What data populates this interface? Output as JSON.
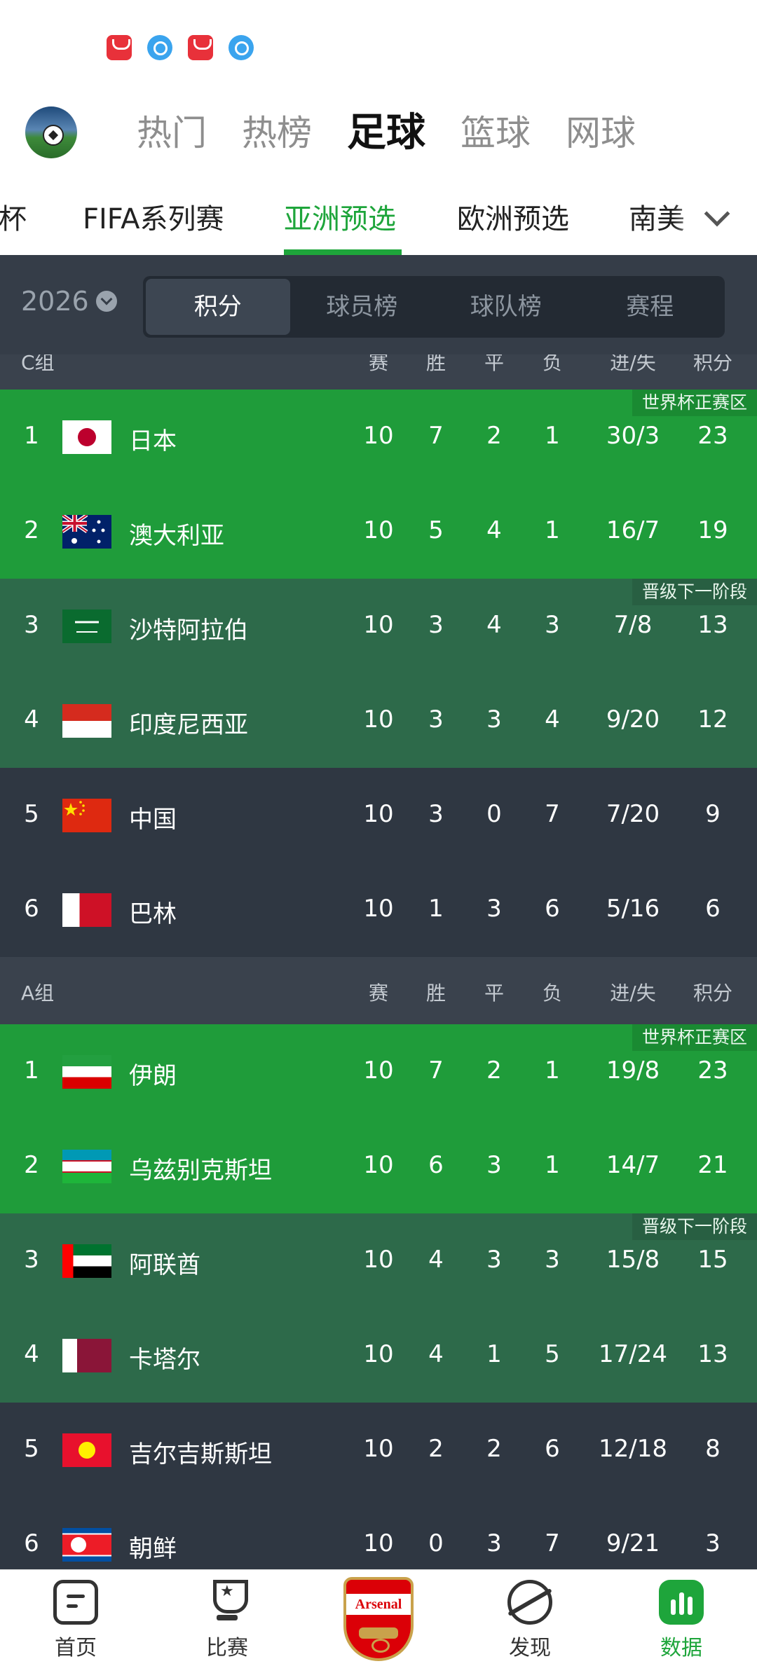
{
  "top_tabs": [
    "热门",
    "热榜",
    "足球",
    "篮球",
    "网球"
  ],
  "sub_tabs": [
    "杯",
    "FIFA系列赛",
    "亚洲预选",
    "欧洲预选",
    "南美"
  ],
  "season": "2026",
  "segments": [
    "积分",
    "球员榜",
    "球队榜",
    "赛程"
  ],
  "headers": [
    "赛",
    "胜",
    "平",
    "负",
    "进/失",
    "积分"
  ],
  "tags": {
    "world_cup": "世界杯正赛区",
    "next": "晋级下一阶段"
  },
  "groups": [
    {
      "name": "C组",
      "rows": [
        {
          "rank": "1",
          "team": "日本",
          "p": "10",
          "w": "7",
          "d": "2",
          "l": "1",
          "gd": "30/3",
          "pts": "23"
        },
        {
          "rank": "2",
          "team": "澳大利亚",
          "p": "10",
          "w": "5",
          "d": "4",
          "l": "1",
          "gd": "16/7",
          "pts": "19"
        },
        {
          "rank": "3",
          "team": "沙特阿拉伯",
          "p": "10",
          "w": "3",
          "d": "4",
          "l": "3",
          "gd": "7/8",
          "pts": "13"
        },
        {
          "rank": "4",
          "team": "印度尼西亚",
          "p": "10",
          "w": "3",
          "d": "3",
          "l": "4",
          "gd": "9/20",
          "pts": "12"
        },
        {
          "rank": "5",
          "team": "中国",
          "p": "10",
          "w": "3",
          "d": "0",
          "l": "7",
          "gd": "7/20",
          "pts": "9"
        },
        {
          "rank": "6",
          "team": "巴林",
          "p": "10",
          "w": "1",
          "d": "3",
          "l": "6",
          "gd": "5/16",
          "pts": "6"
        }
      ]
    },
    {
      "name": "A组",
      "rows": [
        {
          "rank": "1",
          "team": "伊朗",
          "p": "10",
          "w": "7",
          "d": "2",
          "l": "1",
          "gd": "19/8",
          "pts": "23"
        },
        {
          "rank": "2",
          "team": "乌兹别克斯坦",
          "p": "10",
          "w": "6",
          "d": "3",
          "l": "1",
          "gd": "14/7",
          "pts": "21"
        },
        {
          "rank": "3",
          "team": "阿联酋",
          "p": "10",
          "w": "4",
          "d": "3",
          "l": "3",
          "gd": "15/8",
          "pts": "15"
        },
        {
          "rank": "4",
          "team": "卡塔尔",
          "p": "10",
          "w": "4",
          "d": "1",
          "l": "5",
          "gd": "17/24",
          "pts": "13"
        },
        {
          "rank": "5",
          "team": "吉尔吉斯斯坦",
          "p": "10",
          "w": "2",
          "d": "2",
          "l": "6",
          "gd": "12/18",
          "pts": "8"
        },
        {
          "rank": "6",
          "team": "朝鲜",
          "p": "10",
          "w": "0",
          "d": "3",
          "l": "7",
          "gd": "9/21",
          "pts": "3"
        }
      ]
    }
  ],
  "bottom_nav": [
    "首页",
    "比赛",
    "发现",
    "数据"
  ],
  "crest_text": "Arsenal",
  "colors": {
    "accent": "#1ea53b",
    "world_cup_row": "#1f9c3a",
    "next_stage_row": "#2d6a4a",
    "eliminated_row": "#2f3742"
  }
}
